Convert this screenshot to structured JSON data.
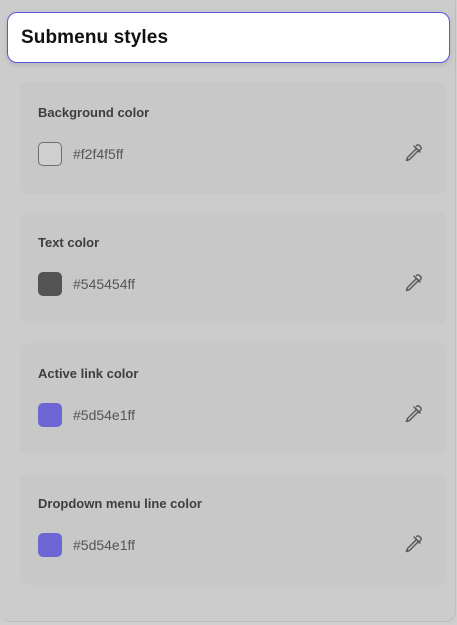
{
  "header": {
    "title": "Submenu styles",
    "accent_color": "#5d54e1"
  },
  "sections": [
    {
      "label": "Background color",
      "value": "#f2f4f5ff",
      "swatch_color": "#cfcfcf",
      "swatch_border": "#6f6f6f",
      "icon": "eyedropper-icon"
    },
    {
      "label": "Text color",
      "value": "#545454ff",
      "swatch_color": "#545454",
      "swatch_border": "#545454",
      "icon": "eyedropper-icon"
    },
    {
      "label": "Active link color",
      "value": "#5d54e1ff",
      "swatch_color": "#6d66d4",
      "swatch_border": "#6d66d4",
      "icon": "eyedropper-icon"
    },
    {
      "label": "Dropdown menu line color",
      "value": "#5d54e1ff",
      "swatch_color": "#6d66d4",
      "swatch_border": "#6d66d4",
      "icon": "eyedropper-icon"
    }
  ]
}
